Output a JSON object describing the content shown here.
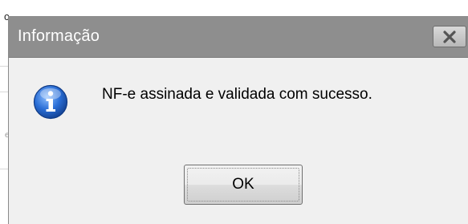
{
  "dialog": {
    "title": "Informação",
    "message": "NF-e assinada e validada com sucesso.",
    "ok_label": "OK"
  },
  "icons": {
    "info": "info-icon",
    "close": "close-icon"
  },
  "colors": {
    "titlebar": "#8e8e8e",
    "body": "#f0f0f0",
    "info_blue": "#1f5fbf"
  }
}
